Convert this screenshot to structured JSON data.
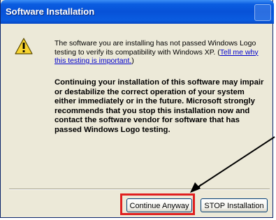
{
  "window": {
    "title": "Software Installation"
  },
  "icon": "warning-icon",
  "message": {
    "text": "The software you are installing has not passed Windows Logo testing to verify its compatibility with Windows XP. (",
    "link": "Tell me why this testing is important.",
    "close": ")"
  },
  "warning_bold": "Continuing your installation of this software may impair or destabilize the correct operation of your system either immediately or in the future. Microsoft strongly recommends that you stop this installation now and contact the software vendor for software that has passed Windows Logo testing.",
  "buttons": {
    "continue_label": "Continue Anyway",
    "stop_label": "STOP Installation"
  },
  "colors": {
    "title_bar": "#0752d8",
    "dialog_bg": "#ece9d8",
    "highlight": "#e02020",
    "link": "#0000cc"
  }
}
